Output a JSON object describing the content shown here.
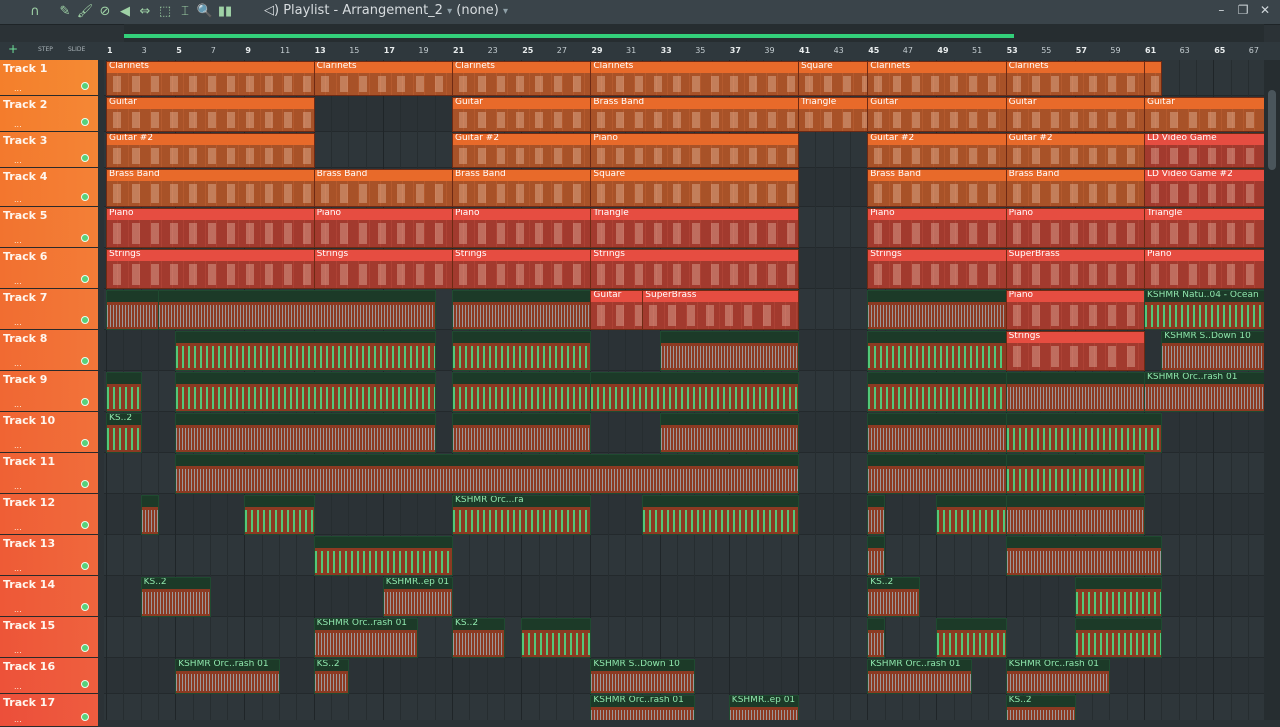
{
  "titlebar": {
    "title": "Playlist - Arrangement_2",
    "pattern": "(none)",
    "tools": [
      {
        "name": "magnet-icon",
        "glyph": "∩"
      },
      {
        "name": "pencil-icon",
        "glyph": "✎"
      },
      {
        "name": "brush-icon",
        "glyph": "🖌"
      },
      {
        "name": "delete-icon",
        "glyph": "⊘"
      },
      {
        "name": "mute-icon",
        "glyph": "◀"
      },
      {
        "name": "slip-icon",
        "glyph": "⇔"
      },
      {
        "name": "select-icon",
        "glyph": "⬚"
      },
      {
        "name": "slice-icon",
        "glyph": "⌶"
      },
      {
        "name": "zoom-icon",
        "glyph": "🔍"
      },
      {
        "name": "playback-icon",
        "glyph": "▮▮"
      }
    ],
    "window_controls": [
      "–",
      "❐",
      "✕"
    ]
  },
  "left_header": {
    "step": "STEP",
    "slide": "SLIDE"
  },
  "ruler_ticks": [
    "1",
    "3",
    "5",
    "7",
    "9",
    "11",
    "13",
    "15",
    "17",
    "19",
    "21",
    "23",
    "25",
    "27",
    "29",
    "31",
    "33",
    "35",
    "37",
    "39",
    "41",
    "43",
    "45",
    "47",
    "49",
    "51",
    "53",
    "55",
    "57",
    "59",
    "61",
    "63",
    "65",
    "67"
  ],
  "tracks": [
    {
      "label": "Track 1",
      "dots": "..."
    },
    {
      "label": "Track 2",
      "dots": "..."
    },
    {
      "label": "Track 3",
      "dots": "..."
    },
    {
      "label": "Track 4",
      "dots": "..."
    },
    {
      "label": "Track 5",
      "dots": "..."
    },
    {
      "label": "Track 6",
      "dots": "..."
    },
    {
      "label": "Track 7",
      "dots": "..."
    },
    {
      "label": "Track 8",
      "dots": "..."
    },
    {
      "label": "Track 9",
      "dots": "..."
    },
    {
      "label": "Track 10",
      "dots": "..."
    },
    {
      "label": "Track 11",
      "dots": "..."
    },
    {
      "label": "Track 12",
      "dots": "..."
    },
    {
      "label": "Track 13",
      "dots": "..."
    },
    {
      "label": "Track 14",
      "dots": "..."
    },
    {
      "label": "Track 15",
      "dots": "..."
    },
    {
      "label": "Track 16",
      "dots": "..."
    },
    {
      "label": "Track 17",
      "dots": "..."
    }
  ],
  "clips": [
    {
      "track": 1,
      "start": 1,
      "end": 13,
      "label": "Clarinets",
      "kind": "pattern"
    },
    {
      "track": 1,
      "start": 13,
      "end": 21,
      "label": "Clarinets",
      "kind": "pattern"
    },
    {
      "track": 1,
      "start": 21,
      "end": 29,
      "label": "Clarinets",
      "kind": "pattern"
    },
    {
      "track": 1,
      "start": 29,
      "end": 41,
      "label": "Clarinets",
      "kind": "pattern"
    },
    {
      "track": 1,
      "start": 41,
      "end": 45,
      "label": "Square",
      "kind": "pattern"
    },
    {
      "track": 1,
      "start": 45,
      "end": 53,
      "label": "Clarinets",
      "kind": "pattern"
    },
    {
      "track": 1,
      "start": 53,
      "end": 61,
      "label": "Clarinets",
      "kind": "pattern"
    },
    {
      "track": 1,
      "start": 61,
      "end": 62,
      "label": "",
      "kind": "pattern"
    },
    {
      "track": 2,
      "start": 1,
      "end": 13,
      "label": "Guitar",
      "kind": "pattern"
    },
    {
      "track": 2,
      "start": 21,
      "end": 29,
      "label": "Guitar",
      "kind": "pattern"
    },
    {
      "track": 2,
      "start": 29,
      "end": 41,
      "label": "Brass Band",
      "kind": "pattern"
    },
    {
      "track": 2,
      "start": 41,
      "end": 45,
      "label": "Triangle",
      "kind": "pattern"
    },
    {
      "track": 2,
      "start": 45,
      "end": 53,
      "label": "Guitar",
      "kind": "pattern"
    },
    {
      "track": 2,
      "start": 53,
      "end": 61,
      "label": "Guitar",
      "kind": "pattern"
    },
    {
      "track": 2,
      "start": 61,
      "end": 68,
      "label": "Guitar",
      "kind": "pattern"
    },
    {
      "track": 3,
      "start": 1,
      "end": 13,
      "label": "Guitar #2",
      "kind": "pattern"
    },
    {
      "track": 3,
      "start": 21,
      "end": 29,
      "label": "Guitar #2",
      "kind": "pattern"
    },
    {
      "track": 3,
      "start": 29,
      "end": 41,
      "label": "Piano",
      "kind": "pattern"
    },
    {
      "track": 3,
      "start": 45,
      "end": 53,
      "label": "Guitar #2",
      "kind": "pattern"
    },
    {
      "track": 3,
      "start": 53,
      "end": 61,
      "label": "Guitar #2",
      "kind": "pattern"
    },
    {
      "track": 3,
      "start": 61,
      "end": 68,
      "label": "LD Video Game",
      "kind": "red"
    },
    {
      "track": 4,
      "start": 1,
      "end": 13,
      "label": "Brass Band",
      "kind": "pattern"
    },
    {
      "track": 4,
      "start": 13,
      "end": 21,
      "label": "Brass Band",
      "kind": "pattern"
    },
    {
      "track": 4,
      "start": 21,
      "end": 29,
      "label": "Brass Band",
      "kind": "pattern"
    },
    {
      "track": 4,
      "start": 29,
      "end": 41,
      "label": "Square",
      "kind": "pattern"
    },
    {
      "track": 4,
      "start": 45,
      "end": 53,
      "label": "Brass Band",
      "kind": "pattern"
    },
    {
      "track": 4,
      "start": 53,
      "end": 61,
      "label": "Brass Band",
      "kind": "pattern"
    },
    {
      "track": 4,
      "start": 61,
      "end": 68,
      "label": "LD Video Game #2",
      "kind": "red"
    },
    {
      "track": 5,
      "start": 1,
      "end": 13,
      "label": "Piano",
      "kind": "red"
    },
    {
      "track": 5,
      "start": 13,
      "end": 21,
      "label": "Piano",
      "kind": "red"
    },
    {
      "track": 5,
      "start": 21,
      "end": 29,
      "label": "Piano",
      "kind": "red"
    },
    {
      "track": 5,
      "start": 29,
      "end": 41,
      "label": "Triangle",
      "kind": "red"
    },
    {
      "track": 5,
      "start": 45,
      "end": 53,
      "label": "Piano",
      "kind": "red"
    },
    {
      "track": 5,
      "start": 53,
      "end": 61,
      "label": "Piano",
      "kind": "red"
    },
    {
      "track": 5,
      "start": 61,
      "end": 68,
      "label": "Triangle",
      "kind": "red"
    },
    {
      "track": 6,
      "start": 1,
      "end": 13,
      "label": "Strings",
      "kind": "red"
    },
    {
      "track": 6,
      "start": 13,
      "end": 21,
      "label": "Strings",
      "kind": "red"
    },
    {
      "track": 6,
      "start": 21,
      "end": 29,
      "label": "Strings",
      "kind": "red"
    },
    {
      "track": 6,
      "start": 29,
      "end": 41,
      "label": "Strings",
      "kind": "red"
    },
    {
      "track": 6,
      "start": 45,
      "end": 53,
      "label": "Strings",
      "kind": "red"
    },
    {
      "track": 6,
      "start": 53,
      "end": 61,
      "label": "SuperBrass",
      "kind": "red"
    },
    {
      "track": 6,
      "start": 61,
      "end": 68,
      "label": "Piano",
      "kind": "red"
    },
    {
      "track": 7,
      "start": 1,
      "end": 4,
      "label": "",
      "kind": "audio-grey"
    },
    {
      "track": 7,
      "start": 4,
      "end": 20,
      "label": "",
      "kind": "audio-grey"
    },
    {
      "track": 7,
      "start": 21,
      "end": 29,
      "label": "",
      "kind": "audio-grey"
    },
    {
      "track": 7,
      "start": 29,
      "end": 32,
      "label": "Guitar",
      "kind": "red"
    },
    {
      "track": 7,
      "start": 32,
      "end": 41,
      "label": "SuperBrass",
      "kind": "red"
    },
    {
      "track": 7,
      "start": 45,
      "end": 53,
      "label": "",
      "kind": "audio-grey"
    },
    {
      "track": 7,
      "start": 53,
      "end": 61,
      "label": "Piano",
      "kind": "red"
    },
    {
      "track": 7,
      "start": 61,
      "end": 68,
      "label": "KSHMR Natu..04 - Ocean",
      "kind": "audio"
    },
    {
      "track": 8,
      "start": 5,
      "end": 20,
      "label": "",
      "kind": "audio"
    },
    {
      "track": 8,
      "start": 21,
      "end": 29,
      "label": "",
      "kind": "audio"
    },
    {
      "track": 8,
      "start": 33,
      "end": 41,
      "label": "",
      "kind": "audio-grey"
    },
    {
      "track": 8,
      "start": 45,
      "end": 53,
      "label": "",
      "kind": "audio"
    },
    {
      "track": 8,
      "start": 53,
      "end": 61,
      "label": "Strings",
      "kind": "red"
    },
    {
      "track": 8,
      "start": 62,
      "end": 68,
      "label": "KSHMR S..Down 10",
      "kind": "audio-grey"
    },
    {
      "track": 9,
      "start": 1,
      "end": 3,
      "label": "",
      "kind": "audio"
    },
    {
      "track": 9,
      "start": 5,
      "end": 20,
      "label": "",
      "kind": "audio"
    },
    {
      "track": 9,
      "start": 21,
      "end": 29,
      "label": "",
      "kind": "audio"
    },
    {
      "track": 9,
      "start": 29,
      "end": 41,
      "label": "",
      "kind": "audio"
    },
    {
      "track": 9,
      "start": 45,
      "end": 53,
      "label": "",
      "kind": "audio"
    },
    {
      "track": 9,
      "start": 53,
      "end": 61,
      "label": "",
      "kind": "audio-grey"
    },
    {
      "track": 9,
      "start": 61,
      "end": 68,
      "label": "KSHMR Orc..rash 01",
      "kind": "audio-grey"
    },
    {
      "track": 10,
      "start": 1,
      "end": 3,
      "label": "KS..2",
      "kind": "audio"
    },
    {
      "track": 10,
      "start": 5,
      "end": 20,
      "label": "",
      "kind": "audio-grey"
    },
    {
      "track": 10,
      "start": 21,
      "end": 29,
      "label": "",
      "kind": "audio-grey"
    },
    {
      "track": 10,
      "start": 33,
      "end": 41,
      "label": "",
      "kind": "audio-grey"
    },
    {
      "track": 10,
      "start": 45,
      "end": 53,
      "label": "",
      "kind": "audio-grey"
    },
    {
      "track": 10,
      "start": 53,
      "end": 62,
      "label": "",
      "kind": "audio"
    },
    {
      "track": 11,
      "start": 5,
      "end": 41,
      "label": "",
      "kind": "audio-grey"
    },
    {
      "track": 11,
      "start": 45,
      "end": 53,
      "label": "",
      "kind": "audio-grey"
    },
    {
      "track": 11,
      "start": 53,
      "end": 61,
      "label": "",
      "kind": "audio"
    },
    {
      "track": 12,
      "start": 3,
      "end": 4,
      "label": "",
      "kind": "audio-grey"
    },
    {
      "track": 12,
      "start": 9,
      "end": 13,
      "label": "",
      "kind": "audio"
    },
    {
      "track": 12,
      "start": 21,
      "end": 29,
      "label": "KSHMR Orc...ra",
      "kind": "audio"
    },
    {
      "track": 12,
      "start": 32,
      "end": 41,
      "label": "",
      "kind": "audio"
    },
    {
      "track": 12,
      "start": 45,
      "end": 46,
      "label": "",
      "kind": "audio-grey"
    },
    {
      "track": 12,
      "start": 49,
      "end": 53,
      "label": "",
      "kind": "audio"
    },
    {
      "track": 12,
      "start": 53,
      "end": 61,
      "label": "",
      "kind": "audio-grey"
    },
    {
      "track": 13,
      "start": 13,
      "end": 21,
      "label": "",
      "kind": "audio"
    },
    {
      "track": 13,
      "start": 45,
      "end": 46,
      "label": "",
      "kind": "audio-grey"
    },
    {
      "track": 13,
      "start": 53,
      "end": 62,
      "label": "",
      "kind": "audio-grey"
    },
    {
      "track": 14,
      "start": 3,
      "end": 7,
      "label": "KS..2",
      "kind": "audio-grey"
    },
    {
      "track": 14,
      "start": 17,
      "end": 21,
      "label": "KSHMR..ep 01",
      "kind": "audio-grey"
    },
    {
      "track": 14,
      "start": 45,
      "end": 48,
      "label": "KS..2",
      "kind": "audio-grey"
    },
    {
      "track": 14,
      "start": 57,
      "end": 62,
      "label": "",
      "kind": "audio"
    },
    {
      "track": 15,
      "start": 13,
      "end": 19,
      "label": "KSHMR Orc..rash 01",
      "kind": "audio-grey"
    },
    {
      "track": 15,
      "start": 21,
      "end": 24,
      "label": "KS..2",
      "kind": "audio-grey"
    },
    {
      "track": 15,
      "start": 25,
      "end": 29,
      "label": "",
      "kind": "audio"
    },
    {
      "track": 15,
      "start": 45,
      "end": 46,
      "label": "",
      "kind": "audio-grey"
    },
    {
      "track": 15,
      "start": 49,
      "end": 53,
      "label": "",
      "kind": "audio"
    },
    {
      "track": 15,
      "start": 57,
      "end": 62,
      "label": "",
      "kind": "audio"
    },
    {
      "track": 16,
      "start": 5,
      "end": 11,
      "label": "KSHMR Orc..rash 01",
      "kind": "audio-grey"
    },
    {
      "track": 16,
      "start": 13,
      "end": 15,
      "label": "KS..2",
      "kind": "audio-grey"
    },
    {
      "track": 16,
      "start": 29,
      "end": 35,
      "label": "KSHMR S..Down 10",
      "kind": "audio-grey"
    },
    {
      "track": 16,
      "start": 45,
      "end": 51,
      "label": "KSHMR Orc..rash 01",
      "kind": "audio-grey"
    },
    {
      "track": 16,
      "start": 53,
      "end": 59,
      "label": "KSHMR Orc..rash 01",
      "kind": "audio-grey"
    },
    {
      "track": 17,
      "start": 29,
      "end": 35,
      "label": "KSHMR Orc..rash 01",
      "kind": "audio-grey"
    },
    {
      "track": 17,
      "start": 37,
      "end": 41,
      "label": "KSHMR..ep 01",
      "kind": "audio-grey"
    },
    {
      "track": 17,
      "start": 53,
      "end": 57,
      "label": "KS..2",
      "kind": "audio-grey"
    }
  ],
  "colors": {
    "accent": "#33d07a",
    "pattern": "#e86a2a",
    "red_pattern": "#e64d41",
    "track_header_top": "#f47f2b",
    "track_header_bottom": "#ec4f3a"
  }
}
